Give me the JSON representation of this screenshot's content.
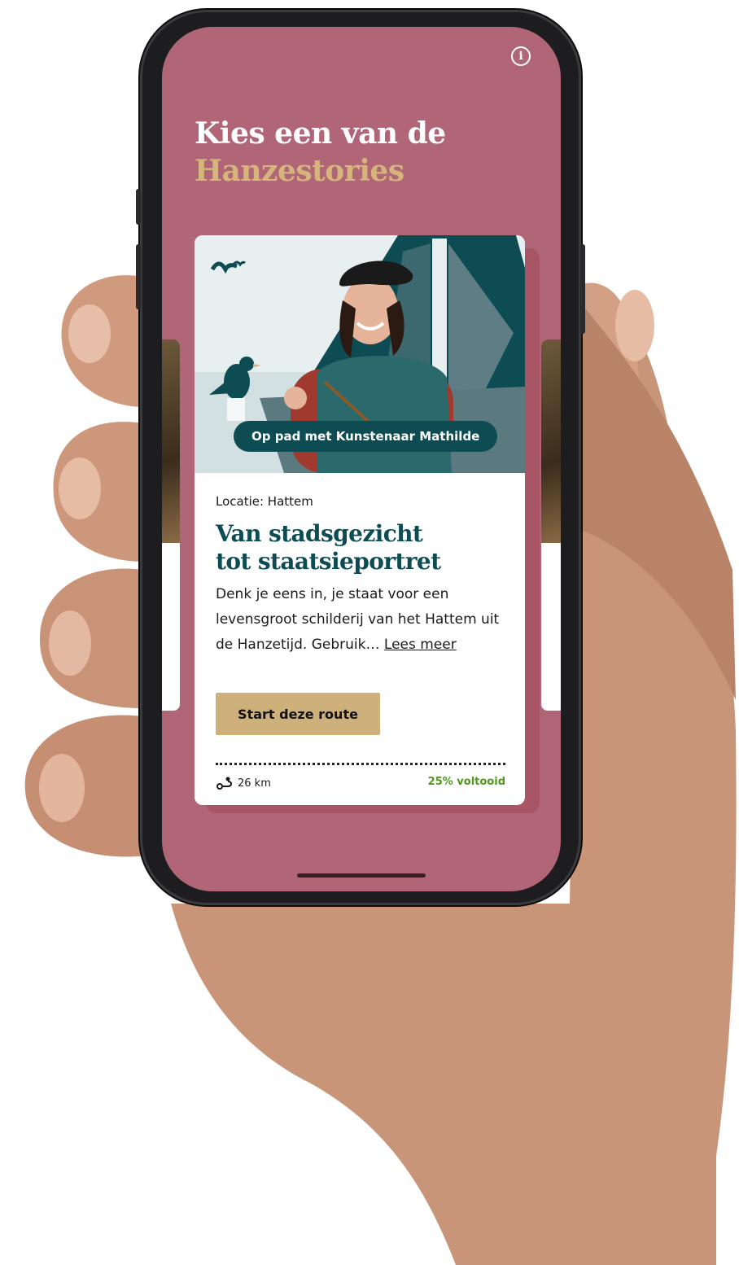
{
  "screen": {
    "info_icon": "info-icon",
    "info_glyph": "i",
    "heading_line1": "Kies een van de",
    "heading_line2": "Hanzestories"
  },
  "card": {
    "badge": "Op pad met Kunstenaar Mathilde",
    "location": "Locatie: Hattem",
    "title_line1": "Van stadsgezicht",
    "title_line2": "tot staatsieportret",
    "description": "Denk je eens in, je staat voor een levensgroot schilderij van het Hattem uit de Hanzetijd. Gebruik…",
    "read_more": "Lees meer",
    "start_button": "Start deze route",
    "distance_icon": "route-icon",
    "distance": "26 km",
    "progress": "25% voltooid"
  },
  "colors": {
    "screen_bg": "#b06677",
    "heading_white": "#ffffff",
    "heading_gold": "#d5b57c",
    "title_teal": "#0e4c54",
    "button_gold": "#cdb07a",
    "progress_green": "#4f9a1c"
  }
}
